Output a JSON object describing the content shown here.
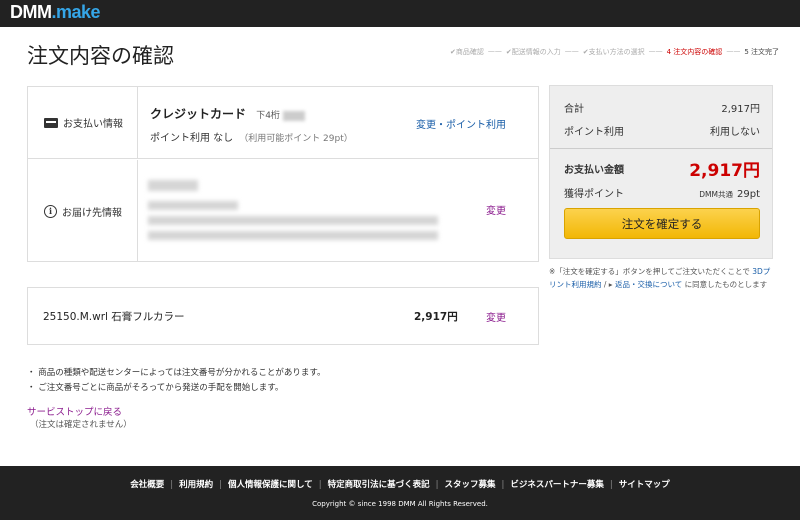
{
  "header": {
    "logo_part1": "DMM",
    "logo_part2": ".make"
  },
  "page_title": "注文内容の確認",
  "steps": [
    {
      "label": "✔商品確認",
      "state": "done"
    },
    {
      "label": "——",
      "state": "sep"
    },
    {
      "label": "✔配送情報の入力",
      "state": "done"
    },
    {
      "label": "——",
      "state": "sep"
    },
    {
      "label": "✔支払い方法の選択",
      "state": "done"
    },
    {
      "label": "——",
      "state": "sep"
    },
    {
      "label": "4 注文内容の確認",
      "state": "current"
    },
    {
      "label": "——",
      "state": "sep"
    },
    {
      "label": "5 注文完了",
      "state": "future"
    }
  ],
  "payment": {
    "label": "お支払い情報",
    "icon": "credit-card-icon",
    "method": "クレジットカード",
    "digits_label": "下4桁",
    "points_text": "ポイント利用 なし",
    "points_sub": "（利用可能ポイント 29pt）",
    "change_link": "変更・ポイント利用"
  },
  "delivery": {
    "label": "お届け先情報",
    "icon": "info-icon",
    "change_link": "変更"
  },
  "item": {
    "name": "25150.M.wrl 石膏フルカラー",
    "price": "2,917円",
    "change_link": "変更"
  },
  "notes": [
    "・ 商品の種類や配送センターによっては注文番号が分かれることがあります。",
    "・ ご注文番号ごとに商品がそろってから発送の手配を開始します。"
  ],
  "back_link": "サービストップに戻る",
  "back_sub": "（注文は確定されません）",
  "summary": {
    "subtotal_label": "合計",
    "subtotal_value": "2,917円",
    "points_use_label": "ポイント利用",
    "points_use_value": "利用しない",
    "total_label": "お支払い金額",
    "total_value": "2,917円",
    "earn_label": "獲得ポイント",
    "earn_prefix": "DMM共通",
    "earn_value": "29pt",
    "confirm_button": "注文を確定する"
  },
  "agree": {
    "part1": "※「注文を確定する」ボタンを押してご注文いただくことで ",
    "link1": "3Dプリント利用規約",
    "part2": " / ▸ ",
    "link2": "返品・交換について",
    "part3": " に同意したものとします"
  },
  "footer": {
    "links": [
      "会社概要",
      "利用規約",
      "個人情報保護に関して",
      "特定商取引法に基づく表記",
      "スタッフ募集",
      "ビジネスパートナー募集",
      "サイトマップ"
    ],
    "copyright": "Copyright © since 1998 DMM All Rights Reserved."
  },
  "colors": {
    "accent_red": "#cc0000",
    "link_blue": "#1a5ea8",
    "link_purple": "#8b1c8e",
    "button_yellow": "#f2b705",
    "dark_bar": "#222222"
  }
}
